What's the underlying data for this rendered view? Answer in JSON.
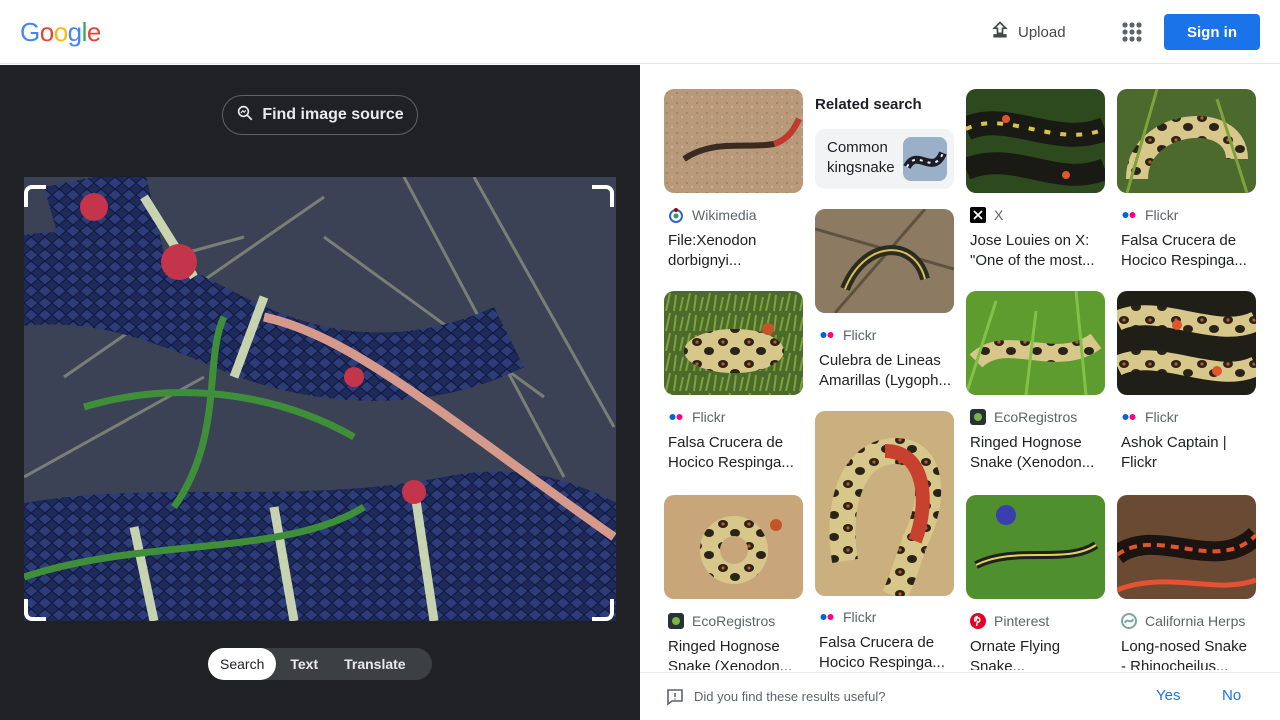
{
  "header": {
    "logo_letters": [
      "G",
      "o",
      "o",
      "g",
      "l",
      "e"
    ],
    "logo_colors": [
      "#4285f4",
      "#ea4335",
      "#fbbc05",
      "#4285f4",
      "#34a853",
      "#ea4335"
    ],
    "upload_label": "Upload",
    "apps_icon": "apps-grid-icon",
    "signin_label": "Sign in"
  },
  "lens": {
    "find_source_label": "Find image source",
    "modes": [
      {
        "label": "Search",
        "active": true
      },
      {
        "label": "Text",
        "active": false
      },
      {
        "label": "Translate",
        "active": false
      }
    ]
  },
  "related": {
    "heading": "Related search",
    "chip_label": "Common kingsnake"
  },
  "results": [
    {
      "source": "Wikimedia",
      "title": "File:Xenodon dorbignyi...",
      "icon": "wikimedia-icon"
    },
    {
      "source": "X",
      "title": "Jose Louies on X: \"One of the most...",
      "icon": "x-icon"
    },
    {
      "source": "Flickr",
      "title": "Falsa Crucera de Hocico Respinga...",
      "icon": "flickr-icon"
    },
    {
      "source": "Flickr",
      "title": "Falsa Crucera de Hocico Respinga...",
      "icon": "flickr-icon"
    },
    {
      "source": "Flickr",
      "title": "Culebra de Lineas Amarillas (Lygoph...",
      "icon": "flickr-icon"
    },
    {
      "source": "EcoRegistros",
      "title": "Ringed Hognose Snake (Xenodon...",
      "icon": "ecoregistros-icon"
    },
    {
      "source": "Flickr",
      "title": "Ashok Captain | Flickr",
      "icon": "flickr-icon"
    },
    {
      "source": "EcoRegistros",
      "title": "Ringed Hognose Snake (Xenodon...",
      "icon": "ecoregistros-icon"
    },
    {
      "source": "Flickr",
      "title": "Falsa Crucera de Hocico Respinga...",
      "icon": "flickr-icon"
    },
    {
      "source": "Pinterest",
      "title": "Ornate Flying Snake...",
      "icon": "pinterest-icon"
    },
    {
      "source": "California Herps",
      "title": "Long-nosed Snake - Rhinocheilus...",
      "icon": "california-herps-icon"
    }
  ],
  "feedback": {
    "question": "Did you find these results useful?",
    "yes": "Yes",
    "no": "No"
  },
  "colors": {
    "accent": "#1a73e8",
    "dark_panel": "#202124",
    "flickr_blue": "#0063dc",
    "flickr_pink": "#ff0084",
    "pinterest_red": "#e60023",
    "eco_green": "#2e7d32"
  }
}
